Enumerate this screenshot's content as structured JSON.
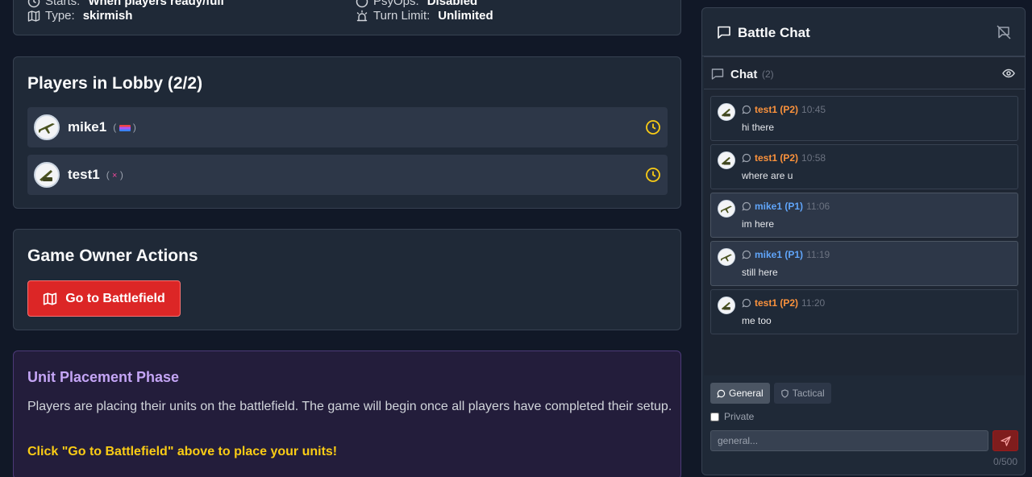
{
  "game_info": {
    "starts_label": "Starts:",
    "starts_value": "When players ready/full",
    "type_label": "Type:",
    "type_value": "skirmish",
    "psyops_label": "PsyOps:",
    "psyops_value": "Disabled",
    "turn_limit_label": "Turn Limit:",
    "turn_limit_value": "Unlimited"
  },
  "lobby": {
    "title": "Players in Lobby (2/2)",
    "players": [
      {
        "name": "mike1",
        "badge_open": "(",
        "badge_close": ")",
        "status_icon": "clock-icon"
      },
      {
        "name": "test1",
        "badge_open": "(",
        "badge_mark": "×",
        "badge_close": ")",
        "status_icon": "clock-icon"
      }
    ]
  },
  "owner_actions": {
    "title": "Game Owner Actions",
    "battlefield_button": "Go to Battlefield"
  },
  "phase": {
    "title": "Unit Placement Phase",
    "description": "Players are placing their units on the battlefield. The game will begin once all players have completed their setup.",
    "cta": "Click \"Go to Battlefield\" above to place your units!"
  },
  "chat": {
    "title": "Battle Chat",
    "section_title": "Chat",
    "count": "(2)",
    "messages": [
      {
        "author": "test1 (P2)",
        "time": "10:45",
        "text": "hi there"
      },
      {
        "author": "test1 (P2)",
        "time": "10:58",
        "text": "where are u"
      },
      {
        "author": "mike1 (P1)",
        "time": "11:06",
        "text": "im here"
      },
      {
        "author": "mike1 (P1)",
        "time": "11:19",
        "text": "still here"
      },
      {
        "author": "test1 (P2)",
        "time": "11:20",
        "text": "me too"
      }
    ],
    "tabs": [
      "General",
      "Tactical"
    ],
    "private_label": "Private",
    "input_placeholder": "general...",
    "char_count": "0/500"
  },
  "colors": {
    "accent_red": "#dc2626",
    "player1": "#60a5fa",
    "player2": "#fb923c",
    "phase_title": "#c4a5f5",
    "cta": "#facc15"
  }
}
